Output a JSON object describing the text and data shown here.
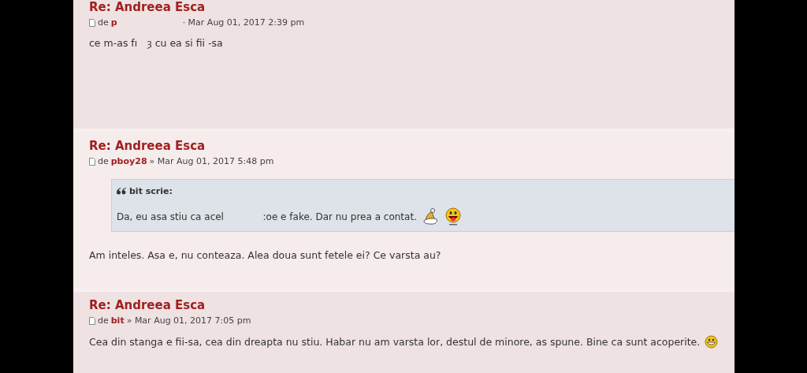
{
  "posts": [
    {
      "title": "Re: Andreea Esca",
      "by": "de",
      "author": "p",
      "separator": "·",
      "date": "Mar Aug 01, 2017 2:39 pm",
      "body": "ce m-as fı   ȝ cu ea si fii -sa"
    },
    {
      "title": "Re: Andreea Esca",
      "by": "de",
      "author": "pboy28",
      "separator": "»",
      "date": "Mar Aug 01, 2017 5:48 pm",
      "quote": {
        "author": "bit scrie:",
        "text": "Da, eu asa stiu ca acel             :oe e fake. Dar nu prea a contat.",
        "smileys": [
          {
            "kind": "hat"
          },
          {
            "kind": "tongue"
          }
        ]
      },
      "body": "Am inteles. Asa e, nu conteaza. Alea doua sunt fetele ei? Ce varsta au?"
    },
    {
      "title": "Re: Andreea Esca",
      "by": "de",
      "author": "bit",
      "separator": "»",
      "date": "Mar Aug 01, 2017 7:05 pm",
      "body": "Cea din stanga e fii-sa, cea din dreapta nu stiu. Habar nu am varsta lor, destul de minore, as spune. Bine ca sunt acoperite.",
      "smileys": [
        {
          "kind": "grin"
        }
      ]
    }
  ]
}
